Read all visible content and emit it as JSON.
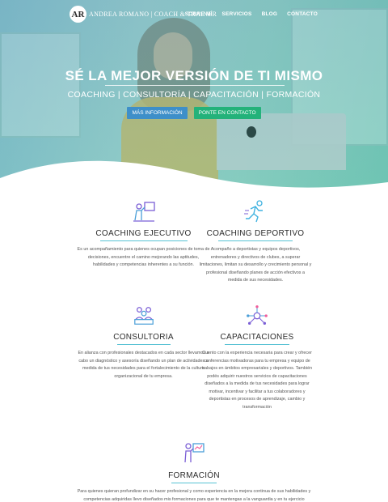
{
  "brand": {
    "initials": "AR",
    "name": "ANDREA ROMANO | COACH & TRAINER"
  },
  "nav": [
    "SOBRE MÍ",
    "SERVICIOS",
    "BLOG",
    "CONTACTO"
  ],
  "hero": {
    "title": "SÉ LA MEJOR VERSIÓN DE TI MISMO",
    "subtitle": "COACHING | CONSULTORÍA | CAPACITACIÓN | FORMACIÓN",
    "btn_info": "MÁS INFORMACIÓN",
    "btn_contact": "PONTE EN CONTACTO"
  },
  "services": [
    {
      "title": "COACHING EJECUTIVO",
      "icon": "executive-coaching-icon",
      "text": "Es un acompañamiento para quienes ocupan posiciones de toma de decisiones, encuentre el camino mejorando las aptitudes, habilidades y competencias inherentes a su función."
    },
    {
      "title": "COACHING DEPORTIVO",
      "icon": "runner-icon",
      "text": "Acompaño a deportistas y equipos deportivos, entrenadores y directivos de clubes, a superar limitaciones, limitan su desarrollo y crecimiento personal y profesional diseñando planes de acción efectivos a medida de sus necesidades."
    },
    {
      "title": "CONSULTORIA",
      "icon": "team-meeting-icon",
      "text": "En alianza con profesionales destacados en cada sector llevamos a cabo un diagnóstico y asesoría diseñando un plan de actividades a medida de tus necesidades para el fortalecimiento de la cultura organizacional de tu empresa."
    },
    {
      "title": "CAPACITACIONES",
      "icon": "network-head-icon",
      "text": "Cuento con la experiencia necesaria para crear y ofrecer conferencias motivadoras para tu empresa y equipo de trabajos en ámbitos empresariales y deportivos. También podés adquirir nuestros servicios de capacitaciones diseñados a la medida de tus necesidades para lograr motivar, incentivar y facilitar a tus colaboradores y deportistas en procesos de aprendizaje, cambio y transformación"
    },
    {
      "title": "FORMACIÓN",
      "icon": "presentation-icon",
      "text": "Para quienes quieran profundizar en su hacer profesional y como experiencia en la mejora continua de sus habilidades y competencias adquiridas llevo diseñados mis formaciones para que te mantengas a la vanguardia y en tu ejercicio profesional."
    }
  ],
  "colors": {
    "accent_blue": "#3e8fc9",
    "accent_green": "#23b27a",
    "icon_purple": "#7b5fd6",
    "line_teal": "#58c2d4"
  }
}
